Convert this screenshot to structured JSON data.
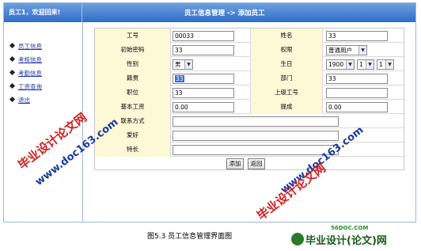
{
  "header": {
    "welcome": "员工1，欢迎回来!",
    "title": "员工信息管理 -> 添加员工"
  },
  "sidebar": {
    "items": [
      {
        "label": "员工信息"
      },
      {
        "label": "考核信息"
      },
      {
        "label": "考勤信息"
      },
      {
        "label": "工资查询"
      },
      {
        "label": "退出"
      }
    ]
  },
  "form": {
    "emp_id_label": "工号",
    "emp_id_value": "00033",
    "name_label": "姓名",
    "name_value": "33",
    "password_label": "初始密码",
    "password_value": "33",
    "role_label": "权限",
    "role_value": "普通用户",
    "gender_label": "性别",
    "gender_value": "男",
    "birthday_label": "生日",
    "birth_year": "1900",
    "birth_month": "1",
    "birth_day": "1",
    "native_label": "籍贯",
    "native_value": "33",
    "dept_label": "部门",
    "dept_value": "33",
    "position_label": "职位",
    "position_value": "33",
    "manager_label": "上级工号",
    "manager_value": "",
    "salary_label": "基本工资",
    "salary_value": "0.00",
    "bonus_label": "提成",
    "bonus_value": "0.00",
    "contact_label": "联系方式",
    "contact_value": "",
    "hobby_label": "爱好",
    "hobby_value": "",
    "skill_label": "特长",
    "skill_value": "",
    "add_button": "添加",
    "back_button": "返回"
  },
  "watermarks": {
    "site1": "www.doc163.com",
    "site2": "毕业设计论文网",
    "site3": "www.doc163.com",
    "site4": "毕业设计论文网"
  },
  "caption": "图5.3  员工信息管理界面图",
  "logo": {
    "small": "56DOC.COM",
    "big": "毕业设计(论文)网"
  }
}
